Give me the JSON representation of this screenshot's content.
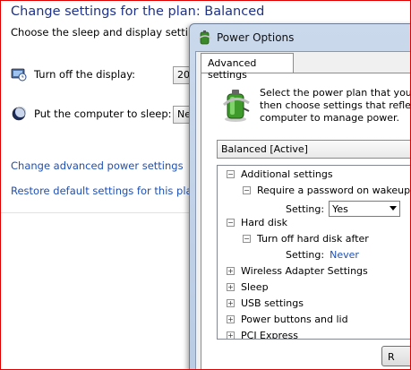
{
  "panel": {
    "title": "Change settings for the plan: Balanced",
    "subtitle": "Choose the sleep and display settings",
    "display_label": "Turn off the display:",
    "display_value": "20",
    "sleep_label": "Put the computer to sleep:",
    "sleep_value": "Ne",
    "link_advanced": "Change advanced power settings",
    "link_restore": "Restore default settings for this plan"
  },
  "dialog": {
    "title": "Power Options",
    "tab": "Advanced settings",
    "desc_line1": "Select the power plan that you w",
    "desc_line2": "then choose settings that reflect",
    "desc_line3": "computer to manage power.",
    "plan": "Balanced [Active]",
    "tree": {
      "additional": "Additional settings",
      "password": "Require a password on wakeup",
      "setting_label": "Setting:",
      "password_value": "Yes",
      "harddisk": "Hard disk",
      "turnoff_disk": "Turn off hard disk after",
      "setting_label2": "Setting:",
      "disk_value": "Never",
      "wireless": "Wireless Adapter Settings",
      "sleep": "Sleep",
      "usb": "USB settings",
      "buttons": "Power buttons and lid",
      "pci": "PCI Express"
    },
    "ok": "R"
  }
}
